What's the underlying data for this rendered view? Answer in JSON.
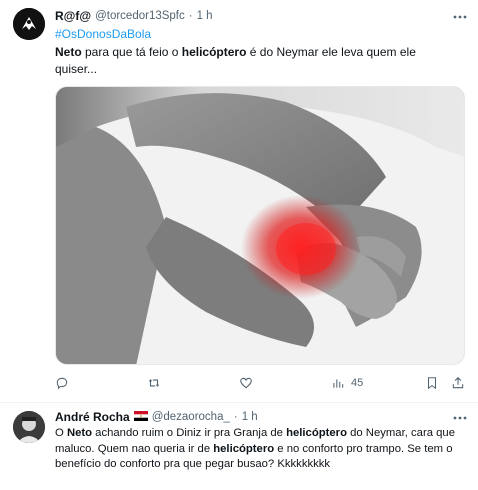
{
  "tweet1": {
    "author_name": "R@f@",
    "handle": "@torcedor13Spfc",
    "separator": "·",
    "time": "1 h",
    "hashtag": "#OsDonosDaBola",
    "text": {
      "part1": "Neto",
      "part2": " para que  tá feio o ",
      "part3": "helicóptero",
      "part4": " é do Neymar ele leva quem ele quiser..."
    },
    "image": {
      "subject": "grayscale photo of a man holding his elbow, elbow highlighted in red"
    },
    "actions": {
      "reply_icon": "reply-icon",
      "retweet_icon": "retweet-icon",
      "like_icon": "heart-icon",
      "views_icon": "views-icon",
      "views_count": "45",
      "bookmark_icon": "bookmark-icon",
      "share_icon": "share-icon"
    }
  },
  "tweet2": {
    "author_name": "André Rocha",
    "flag_icon": "egypt-flag-icon",
    "handle": "@dezaorocha_",
    "separator": "·",
    "time": "1 h",
    "text": {
      "part1": "O ",
      "part2": "Neto",
      "part3": " achando ruim o Diniz ir pra Granja de ",
      "part4": "helicóptero",
      "part5": " do Neymar, cara que maluco. Quem nao queria ir de ",
      "part6": "helicóptero",
      "part7": " e no conforto pro trampo. Se tem o benefício do conforto pra que pegar busao? Kkkkkkkkk"
    }
  },
  "colors": {
    "accent": "#1d9bf0",
    "muted": "#536471",
    "text": "#0f1419",
    "divider": "#eff3f4",
    "highlight": "#ff1a1a"
  }
}
